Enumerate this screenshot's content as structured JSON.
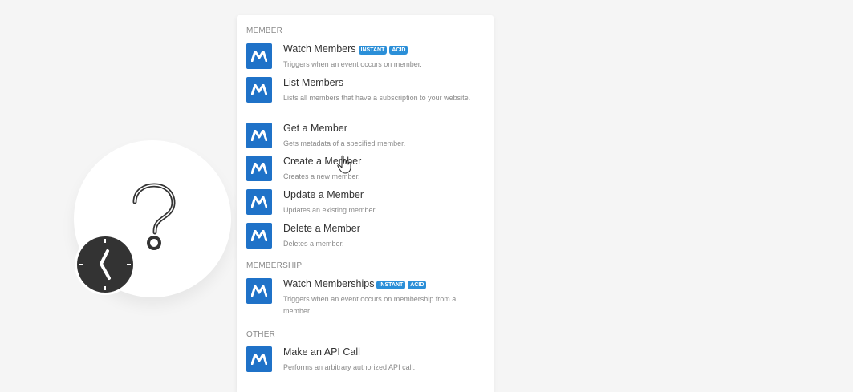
{
  "sections": [
    {
      "header": "MEMBER",
      "items": [
        {
          "title": "Watch Members",
          "badges": [
            "INSTANT",
            "ACID"
          ],
          "desc": "Triggers when an event occurs on member."
        },
        {
          "title": "List Members",
          "badges": [],
          "desc": "Lists all members that have a subscription to your website."
        },
        {
          "title": "Get a Member",
          "badges": [],
          "desc": "Gets metadata of a specified member."
        },
        {
          "title": "Create a Member",
          "badges": [],
          "desc": "Creates a new member."
        },
        {
          "title": "Update a Member",
          "badges": [],
          "desc": "Updates an existing member."
        },
        {
          "title": "Delete a Member",
          "badges": [],
          "desc": "Deletes a member."
        }
      ]
    },
    {
      "header": "MEMBERSHIP",
      "items": [
        {
          "title": "Watch Memberships",
          "badges": [
            "INSTANT",
            "ACID"
          ],
          "desc": "Triggers when an event occurs on membership from a member."
        }
      ]
    },
    {
      "header": "OTHER",
      "items": [
        {
          "title": "Make an API Call",
          "badges": [],
          "desc": "Performs an arbitrary authorized API call."
        }
      ]
    }
  ],
  "colors": {
    "app_icon": "#1f72c8",
    "badge": "#2b8fd8",
    "clock": "#333333"
  },
  "icons": {
    "app": "memberstack-m-icon",
    "placeholder_module": "question-mark-icon",
    "trigger": "clock-icon",
    "pointer": "hand-cursor-icon"
  }
}
